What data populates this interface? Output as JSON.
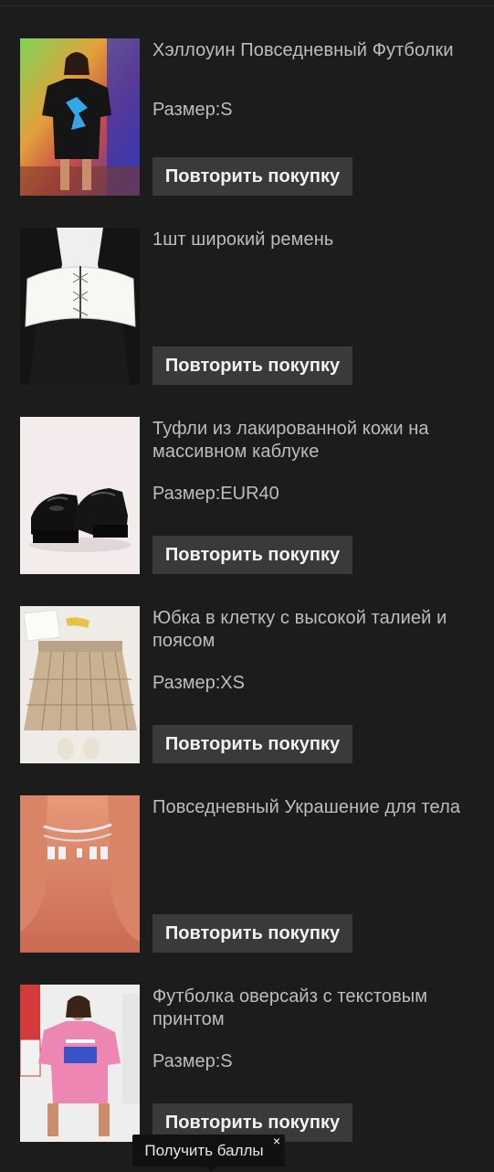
{
  "products": [
    {
      "title": "Хэллоуин Повседневный Футболки",
      "size": "Размер:S",
      "rebuy_label": "Повторить покупку",
      "image_icon": "tshirt-photo"
    },
    {
      "title": "1шт широкий ремень",
      "size": "",
      "rebuy_label": "Повторить покупку",
      "image_icon": "belt-photo"
    },
    {
      "title": "Туфли из лакированной кожи на массивном каблуке",
      "size": "Размер:EUR40",
      "rebuy_label": "Повторить покупку",
      "image_icon": "shoes-photo"
    },
    {
      "title": "Юбка в клетку с высокой талией и поясом",
      "size": "Размер:XS",
      "rebuy_label": "Повторить покупку",
      "image_icon": "skirt-photo"
    },
    {
      "title": "Повседневный Украшение для тела",
      "size": "",
      "rebuy_label": "Повторить покупку",
      "image_icon": "anklet-photo"
    },
    {
      "title": "Футболка оверсайз с текстовым принтом",
      "size": "Размер:S",
      "rebuy_label": "Повторить покупку",
      "image_icon": "oversized-tshirt-photo"
    }
  ],
  "toast": {
    "label": "Получить баллы",
    "close_glyph": "×"
  },
  "colors": {
    "background": "#1c1c1c",
    "button_bg": "#3a3a3a",
    "button_text": "#f2f2f2",
    "text_secondary": "#bdbdbd",
    "toast_bg": "#111111"
  }
}
